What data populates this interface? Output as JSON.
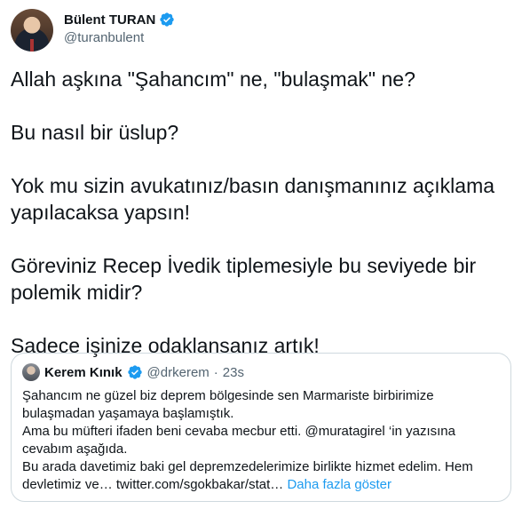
{
  "author": {
    "display_name": "Bülent TURAN",
    "handle": "@turanbulent",
    "verified": true,
    "avatar_icon": "profile-photo"
  },
  "tweet": {
    "paragraphs": [
      "Allah aşkına \"Şahancım\" ne, \"bulaşmak\" ne?",
      "Bu nasıl bir üslup?",
      "Yok mu sizin avukatınız/basın danışmanınız açıklama yapılacaksa yapsın!",
      "Göreviniz Recep İvedik tiplemesiyle bu seviyede bir polemik midir?",
      "Sadece işinize odaklansanız artık!"
    ]
  },
  "quoted_tweet": {
    "display_name": "Kerem Kınık",
    "handle": "@drkerem",
    "separator": "·",
    "time": "23s",
    "verified": true,
    "lines": [
      "Şahancım ne güzel biz deprem bölgesinde sen Marmariste birbirimize",
      "bulaşmadan yaşamaya başlamıştık.",
      "Ama bu müfteri ifaden beni cevaba mecbur etti. @muratagirel ‘in yazısına",
      "cevabım aşağıda.",
      "Bu arada davetimiz baki gel depremzedelerimize birlikte hizmet edelim. Hem"
    ],
    "last_line_text": "devletimiz ve… twitter.com/sgokbakar/stat…",
    "show_more": "Daha fazla göster"
  },
  "colors": {
    "text": "#0f1419",
    "secondary": "#536471",
    "link": "#1d9bf0",
    "verified": "#1d9bf0",
    "border": "#cfd9de"
  }
}
